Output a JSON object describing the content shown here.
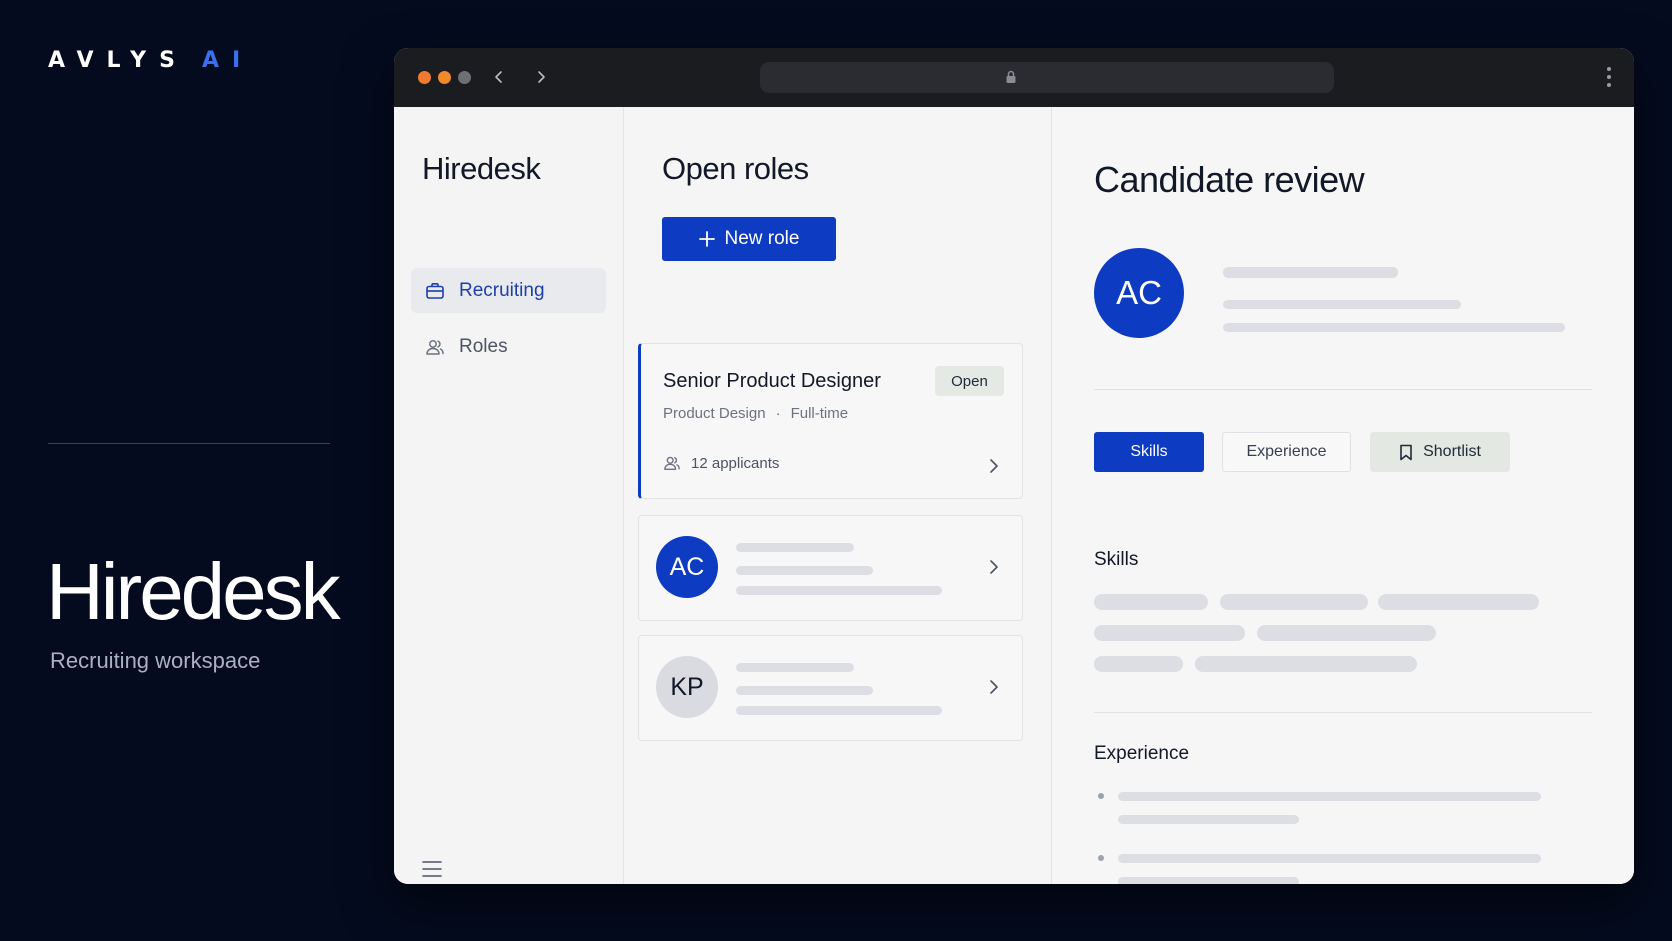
{
  "brand": {
    "logo_main": "AVLYS",
    "logo_accent": "AI",
    "title": "Hiredesk",
    "subtitle": "Recruiting workspace"
  },
  "sidebar": {
    "app_name": "Hiredesk",
    "items": [
      {
        "label": "Recruiting",
        "icon": "briefcase-icon",
        "active": true
      },
      {
        "label": "Roles",
        "icon": "users-icon",
        "active": false
      }
    ]
  },
  "roles_panel": {
    "title": "Open roles",
    "new_role_label": "New role",
    "role_card": {
      "title": "Senior Product Designer",
      "status": "Open",
      "department": "Product Design",
      "employment_type": "Full-time",
      "applicants": "12 applicants"
    },
    "candidates": [
      {
        "initials": "AC"
      },
      {
        "initials": "KP"
      }
    ]
  },
  "review_panel": {
    "title": "Candidate review",
    "initials": "AC",
    "tabs": {
      "skills": "Skills",
      "experience": "Experience",
      "shortlist": "Shortlist"
    },
    "skills_heading": "Skills",
    "experience_heading": "Experience"
  },
  "colors": {
    "background": "#040b1e",
    "accent": "#0d3bc1",
    "logo_accent": "#3b6ff0"
  }
}
